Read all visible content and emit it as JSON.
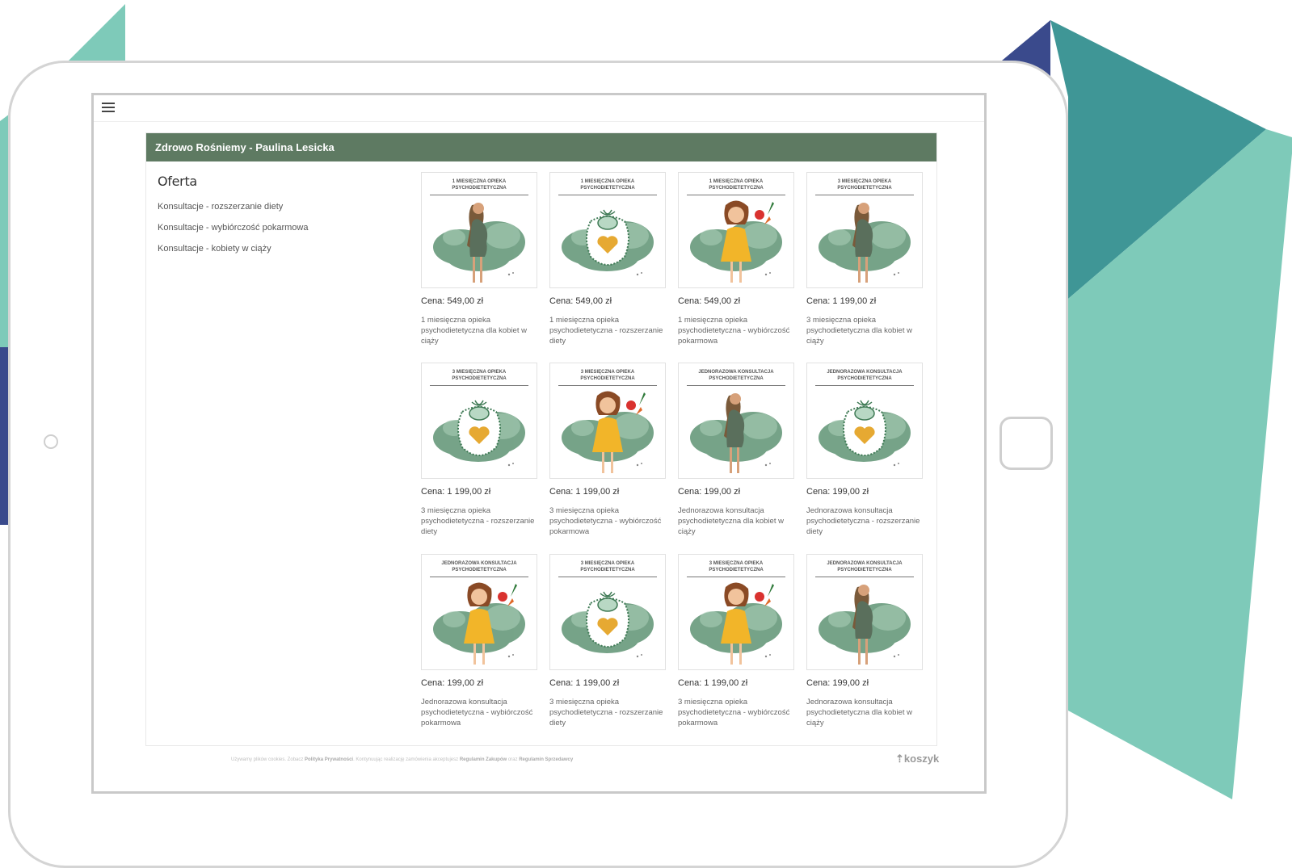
{
  "shop": {
    "title": "Zdrowo Rośniemy - Paulina Lesicka",
    "sidebar_heading": "Oferta",
    "categories": [
      "Konsultacje - rozszerzanie diety",
      "Konsultacje - wybiórczość pokarmowa",
      "Konsultacje - kobiety w ciąży"
    ]
  },
  "products": [
    {
      "image_title": "1 miesięczna opieka psychodietetyczna",
      "image": "pregnant-woman",
      "price": "Cena: 549,00 zł",
      "name": "1 miesięczna opieka psychodietetyczna dla kobiet w ciąży"
    },
    {
      "image_title": "1 miesięczna opieka psychodietetyczna",
      "image": "baby-bib",
      "price": "Cena: 549,00 zł",
      "name": "1 miesięczna opieka psychodietetyczna - rozszerzanie diety"
    },
    {
      "image_title": "1 miesięczna opieka psychodietetyczna",
      "image": "girl-vegetables",
      "price": "Cena: 549,00 zł",
      "name": "1 miesięczna opieka psychodietetyczna - wybiórczość pokarmowa"
    },
    {
      "image_title": "3 miesięczna opieka psychodietetyczna",
      "image": "pregnant-woman",
      "price": "Cena: 1 199,00 zł",
      "name": "3 miesięczna opieka psychodietetyczna dla kobiet w ciąży"
    },
    {
      "image_title": "3 miesięczna opieka psychodietetyczna",
      "image": "baby-bib",
      "price": "Cena: 1 199,00 zł",
      "name": "3 miesięczna opieka psychodietetyczna - rozszerzanie diety"
    },
    {
      "image_title": "3 miesięczna opieka psychodietetyczna",
      "image": "girl-vegetables",
      "price": "Cena: 1 199,00 zł",
      "name": "3 miesięczna opieka psychodietetyczna - wybiórczość pokarmowa"
    },
    {
      "image_title": "Jednorazowa konsultacja psychodietetyczna",
      "image": "pregnant-woman",
      "price": "Cena: 199,00 zł",
      "name": "Jednorazowa konsultacja psychodietetyczna dla kobiet w ciąży"
    },
    {
      "image_title": "Jednorazowa konsultacja psychodietetyczna",
      "image": "baby-bib",
      "price": "Cena: 199,00 zł",
      "name": "Jednorazowa konsultacja psychodietetyczna - rozszerzanie diety"
    },
    {
      "image_title": "Jednorazowa konsultacja psychodietetyczna",
      "image": "girl-vegetables",
      "price": "Cena: 199,00 zł",
      "name": "Jednorazowa konsultacja psychodietetyczna - wybiórczość pokarmowa"
    },
    {
      "image_title": "3 miesięczna opieka psychodietetyczna",
      "image": "baby-bib",
      "price": "Cena: 1 199,00 zł",
      "name": "3 miesięczna opieka psychodietetyczna - rozszerzanie diety"
    },
    {
      "image_title": "3 miesięczna opieka psychodietetyczna",
      "image": "girl-vegetables",
      "price": "Cena: 1 199,00 zł",
      "name": "3 miesięczna opieka psychodietetyczna - wybiórczość pokarmowa"
    },
    {
      "image_title": "Jednorazowa konsultacja psychodietetyczna",
      "image": "pregnant-woman",
      "price": "Cena: 199,00 zł",
      "name": "Jednorazowa konsultacja psychodietetyczna dla kobiet w ciąży"
    }
  ],
  "footer": {
    "text_1": "Używamy plików cookies. Zobacz",
    "link_privacy": "Polityka Prywatności",
    "text_2": ". Kontynuując realizację zamówienia akceptujesz",
    "link_terms": "Regulamin Zakupów",
    "text_3": "oraz",
    "link_seller": "Regulamin Sprzedawcy",
    "logo": "koszyk"
  },
  "colors": {
    "header_green": "#5e7a62",
    "teal_light": "#7ecab9",
    "teal_dark": "#3f9696",
    "navy": "#3a4a8c"
  }
}
